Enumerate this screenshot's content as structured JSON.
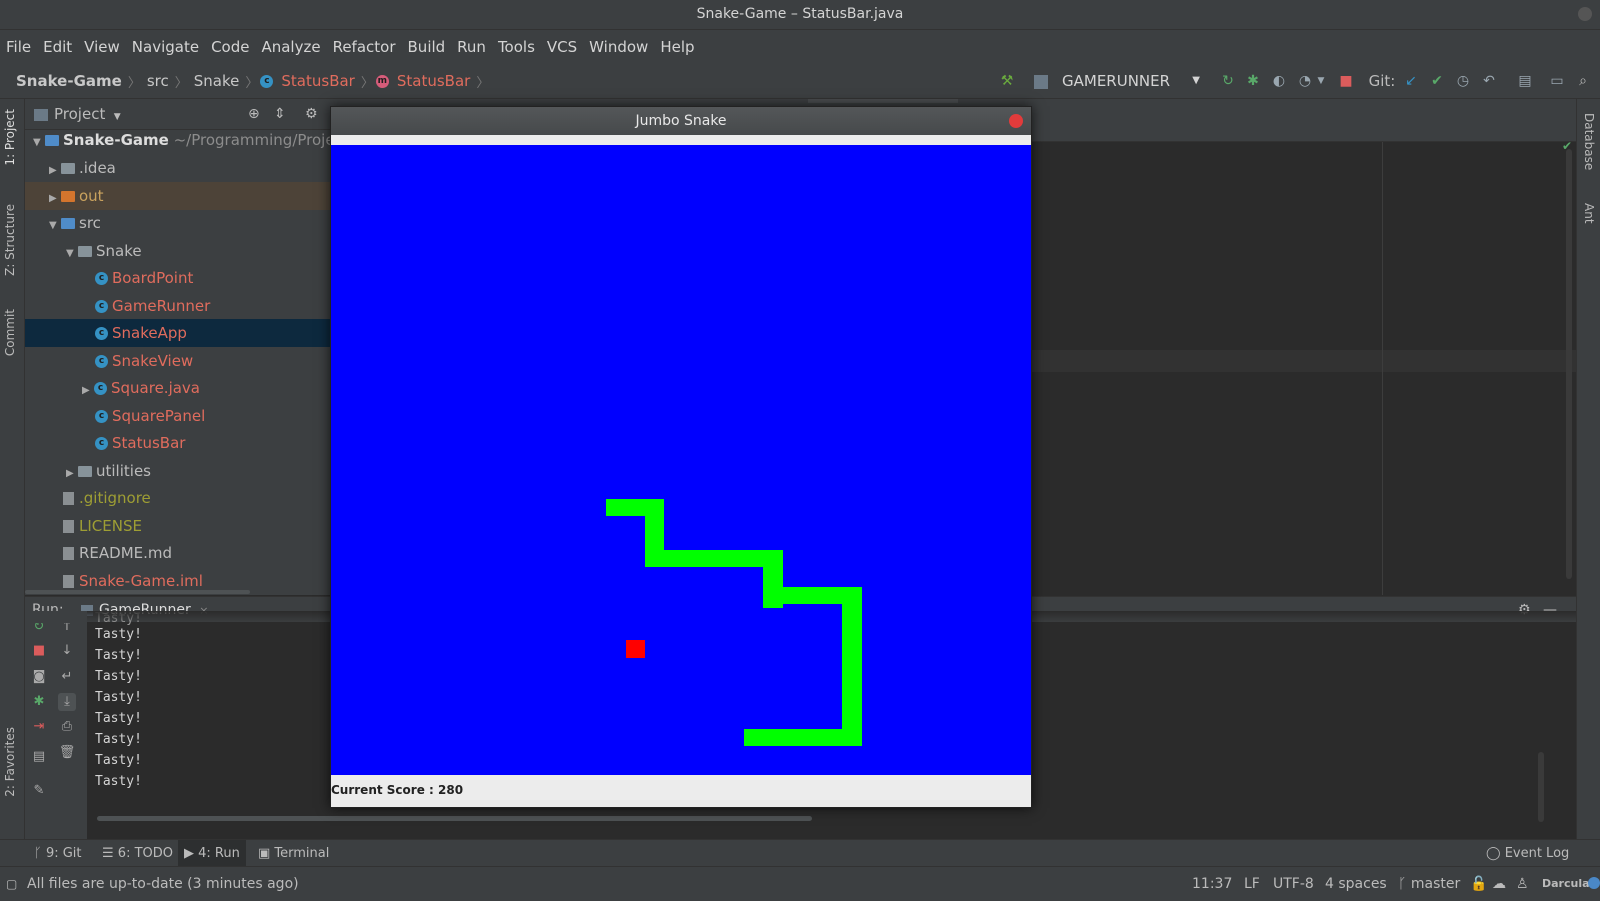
{
  "window": {
    "title": "Snake-Game – StatusBar.java"
  },
  "menu": [
    "File",
    "Edit",
    "View",
    "Navigate",
    "Code",
    "Analyze",
    "Refactor",
    "Build",
    "Run",
    "Tools",
    "VCS",
    "Window",
    "Help"
  ],
  "breadcrumb": {
    "project": "Snake-Game",
    "src": "src",
    "pkg": "Snake",
    "cls": "StatusBar",
    "method": "StatusBar"
  },
  "toolbar": {
    "run_config": "GAMERUNNER",
    "git_label": "Git:"
  },
  "left_tabs": {
    "project": "1: Project",
    "structure": "Z: Structure",
    "commit": "Commit",
    "favorites": "2: Favorites"
  },
  "right_tabs": {
    "database": "Database",
    "ant": "Ant"
  },
  "project_panel": {
    "title": "Project",
    "root_name": "Snake-Game",
    "root_path": "~/Programming/Project",
    "items": [
      {
        "label": ".idea"
      },
      {
        "label": "out"
      },
      {
        "label": "src"
      },
      {
        "label": "Snake"
      },
      {
        "label": "BoardPoint"
      },
      {
        "label": "GameRunner"
      },
      {
        "label": "SnakeApp"
      },
      {
        "label": "SnakeView"
      },
      {
        "label": "Square.java"
      },
      {
        "label": "SquarePanel"
      },
      {
        "label": "StatusBar"
      },
      {
        "label": "utilities"
      },
      {
        "label": ".gitignore"
      },
      {
        "label": "LICENSE"
      },
      {
        "label": "README.md"
      },
      {
        "label": "Snake-Game.iml"
      }
    ]
  },
  "run_panel": {
    "label": "Run:",
    "tab": "GameRunner",
    "output": [
      "Tasty!",
      "Tasty!",
      "Tasty!",
      "Tasty!",
      "Tasty!",
      "Tasty!",
      "Tasty!",
      "Tasty!",
      "Tasty!"
    ]
  },
  "bottom_tabs": {
    "git": "9: Git",
    "todo": "6: TODO",
    "run": "4: Run",
    "terminal": "Terminal",
    "event_log": "Event Log"
  },
  "status": {
    "message": "All files are up-to-date (3 minutes ago)",
    "position": "11:37",
    "line_sep": "LF",
    "encoding": "UTF-8",
    "indent": "4 spaces",
    "branch": "master",
    "theme": "Darcula"
  },
  "game": {
    "title": "Jumbo Snake",
    "score_text": "Current Score : 280",
    "board_color": "#0000ff",
    "snake_color": "#00ff00",
    "food_color": "#ff0000"
  }
}
